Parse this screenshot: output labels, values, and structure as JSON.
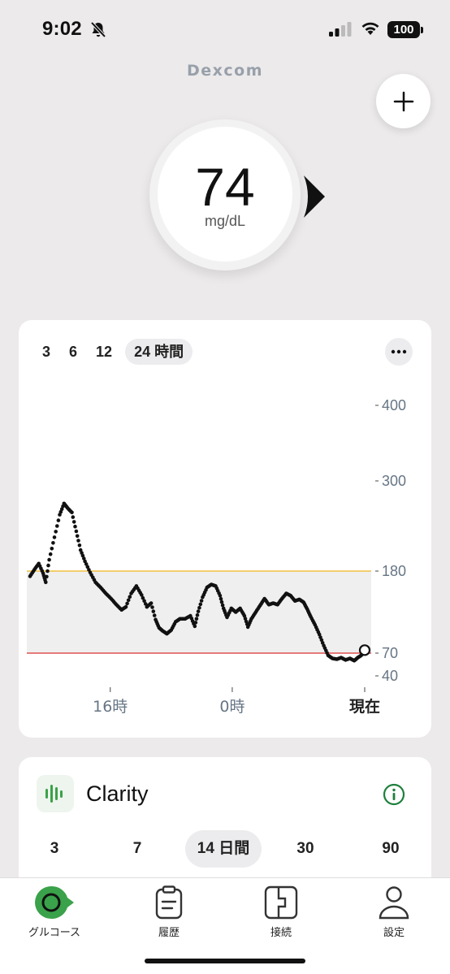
{
  "status_bar": {
    "time": "9:02",
    "battery": "100"
  },
  "brand": "Dexcom",
  "reading": {
    "value": "74",
    "unit": "mg/dL",
    "trend": "steady"
  },
  "chart_card": {
    "range_tabs": [
      {
        "label": "3",
        "active": false
      },
      {
        "label": "6",
        "active": false
      },
      {
        "label": "12",
        "active": false
      },
      {
        "label": "24 時間",
        "active": true
      }
    ],
    "more_icon": "ellipsis-icon"
  },
  "chart_data": {
    "type": "scatter",
    "y_ticks": [
      "400",
      "300",
      "180",
      "70",
      "40"
    ],
    "x_ticks": [
      "16時",
      "0時",
      "現在"
    ],
    "high_threshold": 180,
    "low_threshold": 70,
    "colors": {
      "high_line": "#f0c040",
      "low_line": "#e05050",
      "target_band": "#efefef",
      "points": "#111111"
    },
    "series": [
      {
        "x": 0.0,
        "y": 173
      },
      {
        "x": 0.25,
        "y": 182
      },
      {
        "x": 0.5,
        "y": 190
      },
      {
        "x": 0.75,
        "y": 177
      },
      {
        "x": 0.9,
        "y": 165
      },
      {
        "x": 1.1,
        "y": 195
      },
      {
        "x": 1.4,
        "y": 225
      },
      {
        "x": 1.7,
        "y": 255
      },
      {
        "x": 1.95,
        "y": 270
      },
      {
        "x": 2.15,
        "y": 264
      },
      {
        "x": 2.4,
        "y": 258
      },
      {
        "x": 2.65,
        "y": 233
      },
      {
        "x": 2.9,
        "y": 208
      },
      {
        "x": 3.15,
        "y": 193
      },
      {
        "x": 3.45,
        "y": 178
      },
      {
        "x": 3.75,
        "y": 165
      },
      {
        "x": 4.05,
        "y": 158
      },
      {
        "x": 4.35,
        "y": 150
      },
      {
        "x": 4.65,
        "y": 143
      },
      {
        "x": 4.95,
        "y": 135
      },
      {
        "x": 5.25,
        "y": 128
      },
      {
        "x": 5.5,
        "y": 132
      },
      {
        "x": 5.8,
        "y": 150
      },
      {
        "x": 6.1,
        "y": 160
      },
      {
        "x": 6.4,
        "y": 148
      },
      {
        "x": 6.7,
        "y": 132
      },
      {
        "x": 6.95,
        "y": 137
      },
      {
        "x": 7.2,
        "y": 115
      },
      {
        "x": 7.4,
        "y": 104
      },
      {
        "x": 7.6,
        "y": 100
      },
      {
        "x": 7.85,
        "y": 96
      },
      {
        "x": 8.1,
        "y": 101
      },
      {
        "x": 8.35,
        "y": 112
      },
      {
        "x": 8.6,
        "y": 116
      },
      {
        "x": 8.9,
        "y": 116
      },
      {
        "x": 9.2,
        "y": 120
      },
      {
        "x": 9.45,
        "y": 106
      },
      {
        "x": 9.65,
        "y": 126
      },
      {
        "x": 9.9,
        "y": 145
      },
      {
        "x": 10.15,
        "y": 158
      },
      {
        "x": 10.4,
        "y": 162
      },
      {
        "x": 10.65,
        "y": 160
      },
      {
        "x": 10.9,
        "y": 147
      },
      {
        "x": 11.1,
        "y": 130
      },
      {
        "x": 11.3,
        "y": 118
      },
      {
        "x": 11.55,
        "y": 130
      },
      {
        "x": 11.8,
        "y": 125
      },
      {
        "x": 12.05,
        "y": 130
      },
      {
        "x": 12.3,
        "y": 120
      },
      {
        "x": 12.5,
        "y": 105
      },
      {
        "x": 12.7,
        "y": 116
      },
      {
        "x": 12.95,
        "y": 125
      },
      {
        "x": 13.2,
        "y": 134
      },
      {
        "x": 13.45,
        "y": 143
      },
      {
        "x": 13.7,
        "y": 135
      },
      {
        "x": 13.95,
        "y": 137
      },
      {
        "x": 14.2,
        "y": 135
      },
      {
        "x": 14.45,
        "y": 143
      },
      {
        "x": 14.7,
        "y": 150
      },
      {
        "x": 14.95,
        "y": 147
      },
      {
        "x": 15.2,
        "y": 140
      },
      {
        "x": 15.45,
        "y": 142
      },
      {
        "x": 15.7,
        "y": 138
      },
      {
        "x": 15.9,
        "y": 129
      },
      {
        "x": 16.1,
        "y": 119
      },
      {
        "x": 16.35,
        "y": 108
      },
      {
        "x": 16.6,
        "y": 95
      },
      {
        "x": 16.85,
        "y": 80
      },
      {
        "x": 17.1,
        "y": 67
      },
      {
        "x": 17.35,
        "y": 63
      },
      {
        "x": 17.6,
        "y": 62
      },
      {
        "x": 17.85,
        "y": 64
      },
      {
        "x": 18.1,
        "y": 61
      },
      {
        "x": 18.35,
        "y": 63
      },
      {
        "x": 18.6,
        "y": 60
      },
      {
        "x": 18.8,
        "y": 64
      },
      {
        "x": 19.0,
        "y": 67
      },
      {
        "x": 19.2,
        "y": 74
      }
    ],
    "current": {
      "x": 19.2,
      "y": 74
    }
  },
  "clarity": {
    "title": "Clarity",
    "tabs": [
      {
        "label": "3",
        "active": false
      },
      {
        "label": "7",
        "active": false
      },
      {
        "label": "14 日間",
        "active": true
      },
      {
        "label": "30",
        "active": false
      },
      {
        "label": "90",
        "active": false
      }
    ]
  },
  "nav": {
    "items": [
      {
        "label": "グルコース",
        "icon": "glucose-icon"
      },
      {
        "label": "履歴",
        "icon": "history-icon"
      },
      {
        "label": "接続",
        "icon": "connections-icon"
      },
      {
        "label": "設定",
        "icon": "profile-icon"
      }
    ]
  }
}
